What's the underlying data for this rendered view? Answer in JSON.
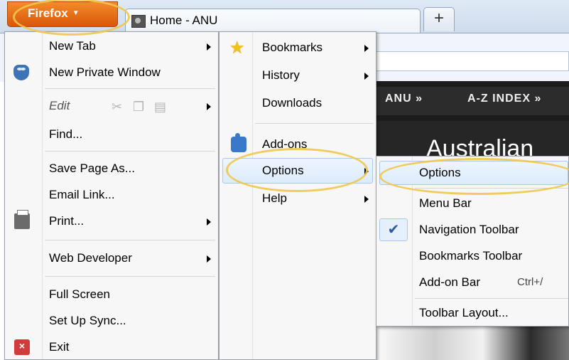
{
  "browser": {
    "app_button_label": "Firefox",
    "tab_title": "Home - ANU",
    "new_tab_label": "+"
  },
  "page": {
    "nav_items": [
      "ANU »",
      "A-Z INDEX »"
    ],
    "hero_text": "Australian"
  },
  "firefox_menu": {
    "items": [
      {
        "label": "New Tab"
      },
      {
        "label": "New Private Window",
        "icon": "private-mask-icon"
      },
      {
        "label": "Edit",
        "icons": [
          "cut-icon",
          "copy-icon",
          "paste-icon"
        ]
      },
      {
        "label": "Find..."
      },
      {
        "label": "Save Page As..."
      },
      {
        "label": "Email Link..."
      },
      {
        "label": "Print...",
        "icon": "printer-icon"
      },
      {
        "label": "Web Developer"
      },
      {
        "label": "Full Screen"
      },
      {
        "label": "Set Up Sync..."
      },
      {
        "label": "Exit",
        "icon": "exit-icon"
      }
    ]
  },
  "right_submenu": {
    "items": [
      {
        "label": "Bookmarks",
        "icon": "star-icon"
      },
      {
        "label": "History"
      },
      {
        "label": "Downloads"
      },
      {
        "label": "Add-ons",
        "icon": "puzzle-icon"
      },
      {
        "label": "Options"
      },
      {
        "label": "Help"
      }
    ]
  },
  "options_submenu": {
    "items": [
      {
        "label": "Options"
      },
      {
        "label": "Menu Bar"
      },
      {
        "label": "Navigation Toolbar",
        "checked": true
      },
      {
        "label": "Bookmarks Toolbar"
      },
      {
        "label": "Add-on Bar",
        "shortcut": "Ctrl+/"
      },
      {
        "label": "Toolbar Layout..."
      }
    ]
  },
  "colors": {
    "firefox_button": "#e0670f",
    "highlight_oval": "#f0c64a",
    "menu_highlight": "#dcebfc"
  }
}
